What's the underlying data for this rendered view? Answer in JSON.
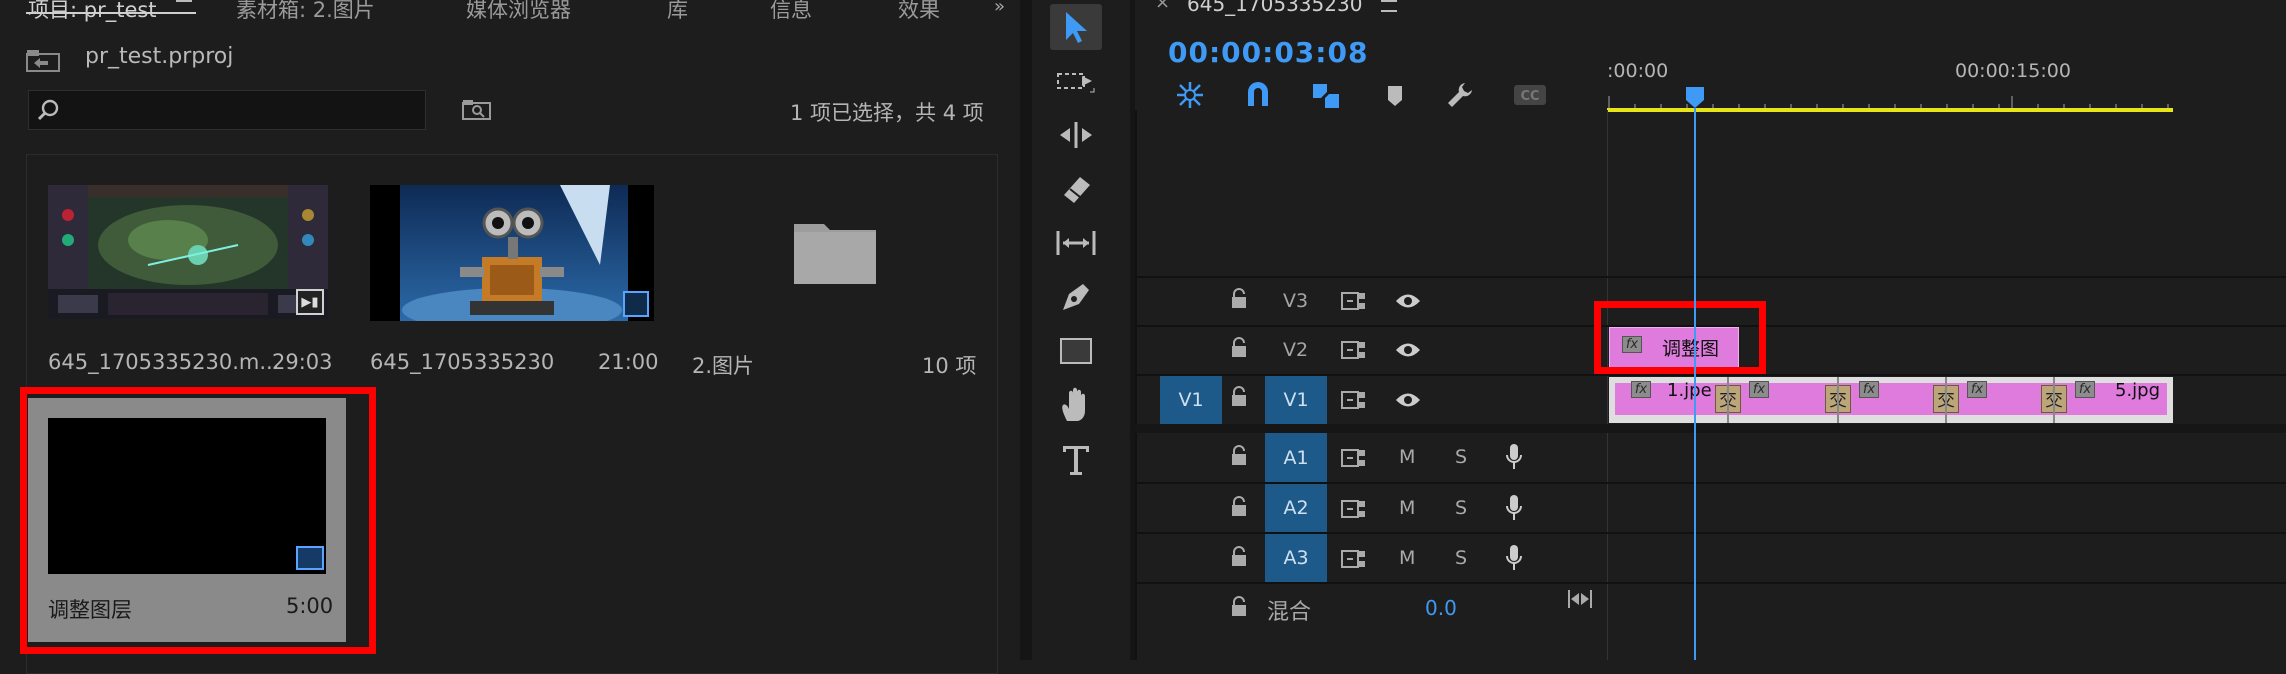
{
  "project_panel": {
    "tabs": [
      {
        "label": "项目: pr_test"
      },
      {
        "label": "素材箱: 2.图片"
      },
      {
        "label": "媒体浏览器"
      },
      {
        "label": "库"
      },
      {
        "label": "信息"
      },
      {
        "label": "效果"
      }
    ],
    "project_file": "pr_test.prproj",
    "search_placeholder": "",
    "selection_status": "1 项已选择，共 4 项",
    "items": [
      {
        "name": "645_1705335230.m...",
        "duration": "29:03"
      },
      {
        "name": "645_1705335230",
        "duration": "21:00"
      },
      {
        "name": "2.图片",
        "duration": "10 项"
      },
      {
        "name": "调整图层",
        "duration": "5:00"
      }
    ]
  },
  "timeline": {
    "sequence_name": "645_1705335230",
    "timecode": "00:00:03:08",
    "ruler": [
      ":00:00",
      "00:00:15:00"
    ],
    "video_tracks": [
      {
        "source": "",
        "label": "V3"
      },
      {
        "source": "",
        "label": "V2"
      },
      {
        "source": "V1",
        "label": "V1"
      }
    ],
    "audio_tracks": [
      {
        "label": "A1",
        "m": "M",
        "s": "S"
      },
      {
        "label": "A2",
        "m": "M",
        "s": "S"
      },
      {
        "label": "A3",
        "m": "M",
        "s": "S"
      }
    ],
    "mix_label": "混合",
    "mix_value": "0.0",
    "clips": {
      "adjustment": "调整图",
      "v1_first": "1.jpe",
      "v1_last": "5.jpg",
      "transition_glyph": "交",
      "fx": "fx"
    }
  },
  "colors": {
    "accent_blue": "#3f9af5",
    "clip_pink": "#df7bdc",
    "track_blue": "#1d5a8a",
    "highlight_red": "#ff0000",
    "work_area_yellow": "#e8e41a"
  }
}
